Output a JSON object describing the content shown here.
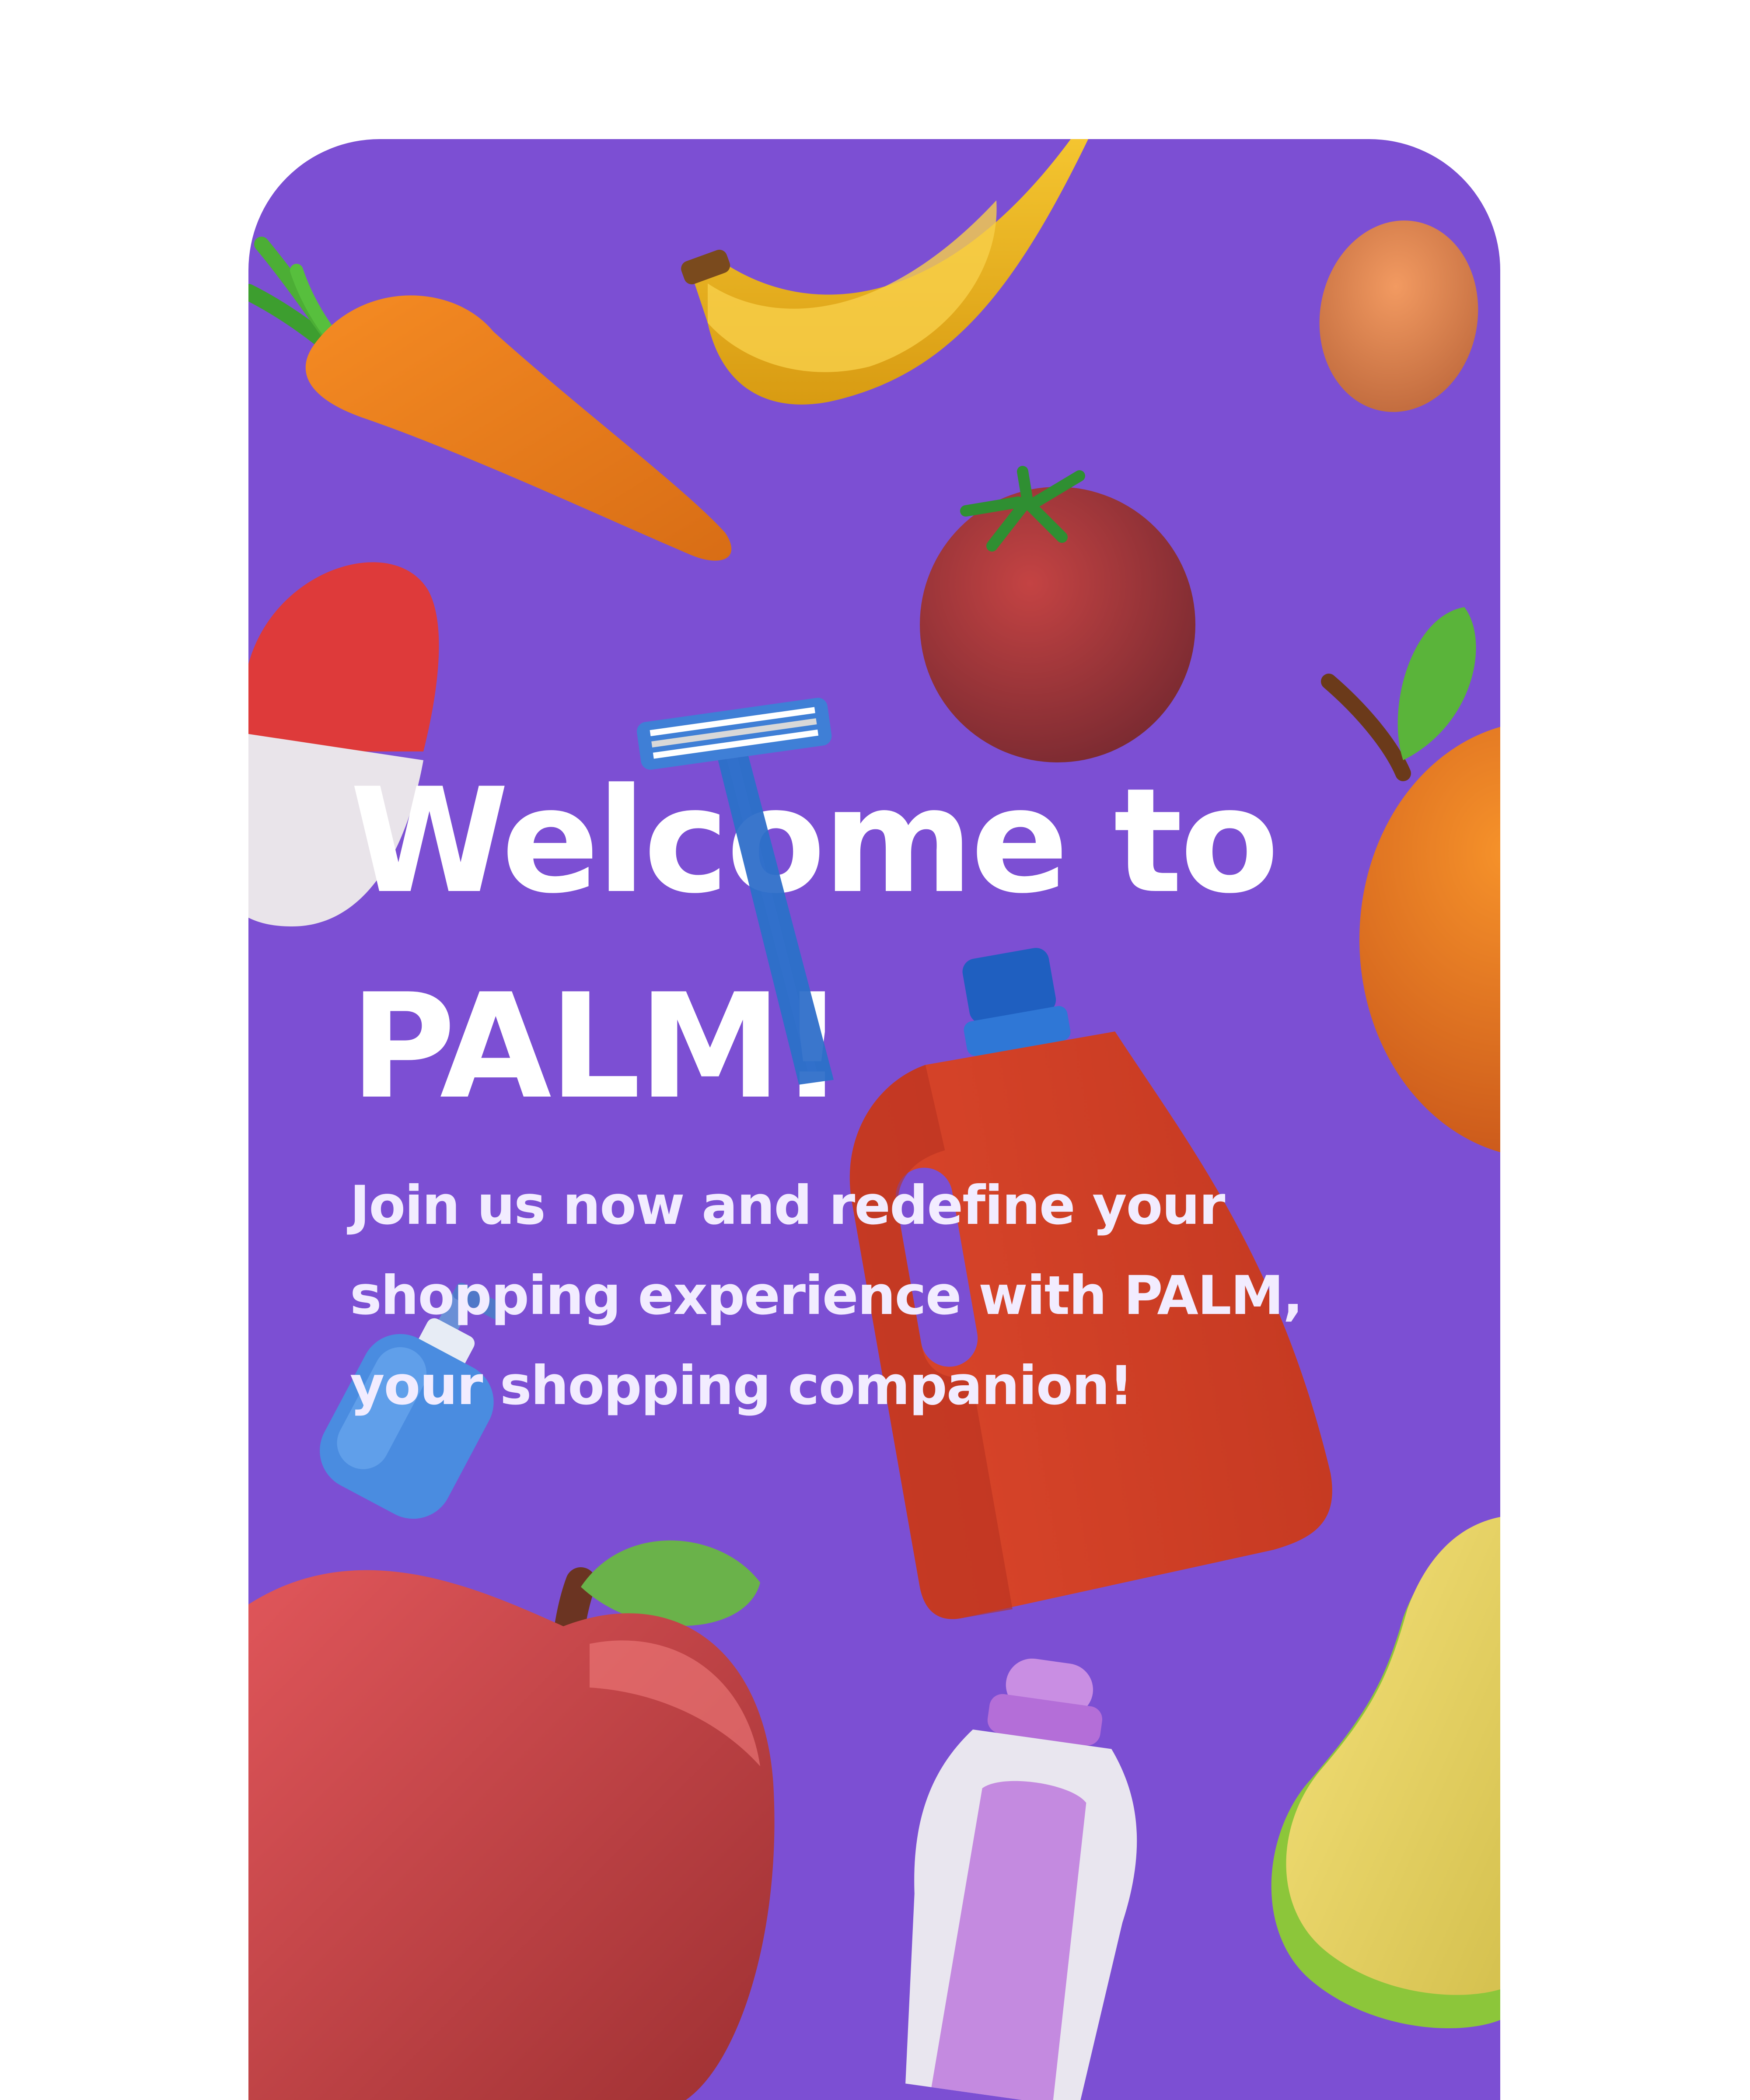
{
  "screen": {
    "background_color": "#7c4fd3",
    "page_background": "#ffffff"
  },
  "welcome": {
    "title_line1": "Welcome to",
    "title_line2": "PALM!",
    "tagline_line1": "Join us now and redefine your",
    "tagline_line2": "shopping experience with PALM,",
    "tagline_line3": "your shopping companion!"
  },
  "illustrations": [
    "carrot-icon",
    "banana-icon",
    "egg-icon",
    "tomato-icon",
    "pill-capsule-icon",
    "razor-icon",
    "orange-icon",
    "detergent-bottle-icon",
    "soap-dispenser-icon",
    "apple-icon",
    "shampoo-bottle-icon",
    "pear-icon"
  ]
}
